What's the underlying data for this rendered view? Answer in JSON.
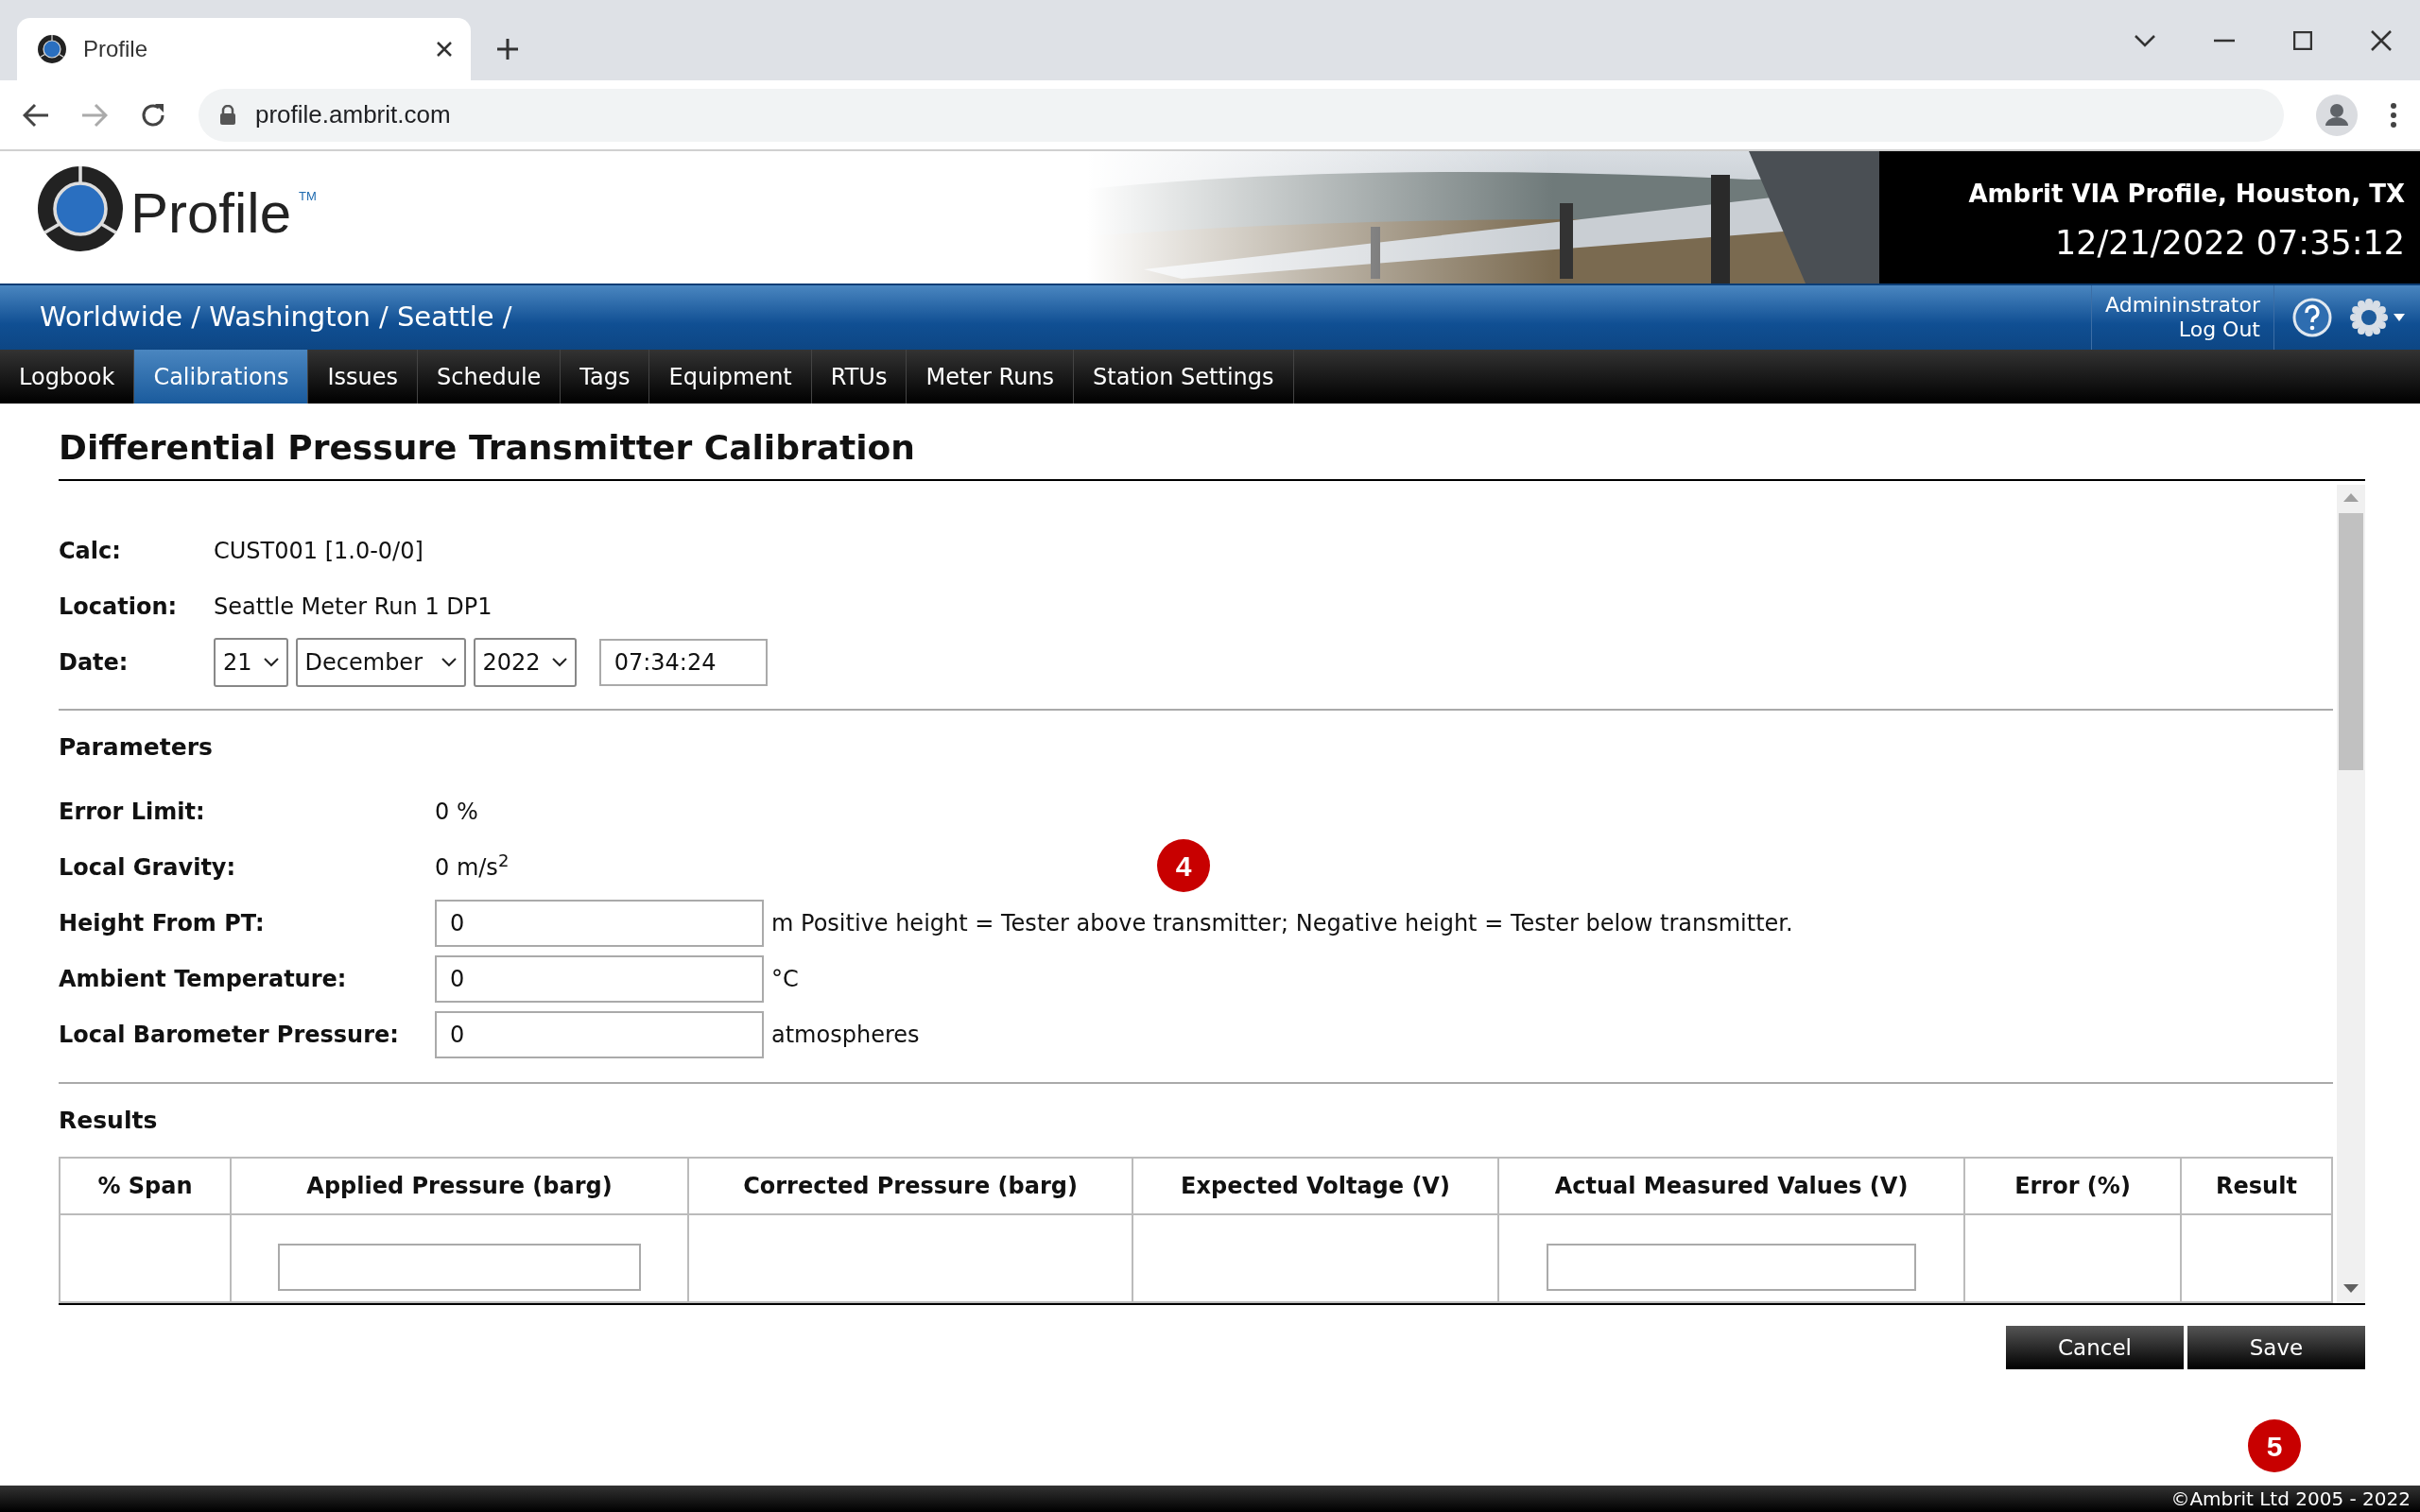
{
  "browser": {
    "tab_title": "Profile",
    "url": "profile.ambrit.com"
  },
  "header": {
    "logo_text": "Profile",
    "trademark": "TM",
    "site": "Ambrit VIA Profile, Houston, TX",
    "datetime": "12/21/2022 07:35:12"
  },
  "breadcrumb": "Worldwide / Washington / Seattle /",
  "user": {
    "name": "Admininstrator",
    "logout": "Log Out"
  },
  "nav": [
    {
      "label": "Logbook",
      "selected": false
    },
    {
      "label": "Calibrations",
      "selected": true
    },
    {
      "label": "Issues",
      "selected": false
    },
    {
      "label": "Schedule",
      "selected": false
    },
    {
      "label": "Tags",
      "selected": false
    },
    {
      "label": "Equipment",
      "selected": false
    },
    {
      "label": "RTUs",
      "selected": false
    },
    {
      "label": "Meter Runs",
      "selected": false
    },
    {
      "label": "Station Settings",
      "selected": false
    }
  ],
  "title": "Differential Pressure Transmitter Calibration",
  "info": [
    {
      "label": "Calc:",
      "value": "CUST001 [1.0-0/0]"
    },
    {
      "label": "Location:",
      "value": "Seattle Meter Run 1 DP1"
    }
  ],
  "date": {
    "label": "Date:",
    "day": "21",
    "month": "December",
    "year": "2022",
    "time": "07:34:24"
  },
  "parameters": {
    "heading": "Parameters",
    "rows": [
      {
        "kind": "text",
        "label": "Error Limit:",
        "value": "0 %"
      },
      {
        "kind": "text",
        "label": "Local Gravity:",
        "value": "0 m/s$^{2}$"
      },
      {
        "kind": "input",
        "label": "Height From PT:",
        "value": "0",
        "unit": "m Positive height = Tester above transmitter; Negative height = Tester below transmitter."
      },
      {
        "kind": "input",
        "label": "Ambient Temperature:",
        "value": "0",
        "unit": "°C"
      },
      {
        "kind": "input",
        "label": "Local Barometer Pressure:",
        "value": "0",
        "unit": "atmospheres"
      }
    ]
  },
  "results": {
    "heading": "Results",
    "columns": [
      "% Span",
      "Applied Pressure (barg)",
      "Corrected Pressure (barg)",
      "Expected Voltage (V)",
      "Actual Measured Values (V)",
      "Error (%)",
      "Result"
    ],
    "row_cells": [
      {
        "kind": "text"
      },
      {
        "kind": "input"
      },
      {
        "kind": "text"
      },
      {
        "kind": "text"
      },
      {
        "kind": "input"
      },
      {
        "kind": "text"
      },
      {
        "kind": "text"
      }
    ]
  },
  "buttons": [
    {
      "label": "Cancel"
    },
    {
      "label": "Save"
    }
  ],
  "footer": "©Ambrit Ltd 2005 - 2022",
  "annotations": [
    {
      "label": "4"
    },
    {
      "label": "5"
    }
  ]
}
